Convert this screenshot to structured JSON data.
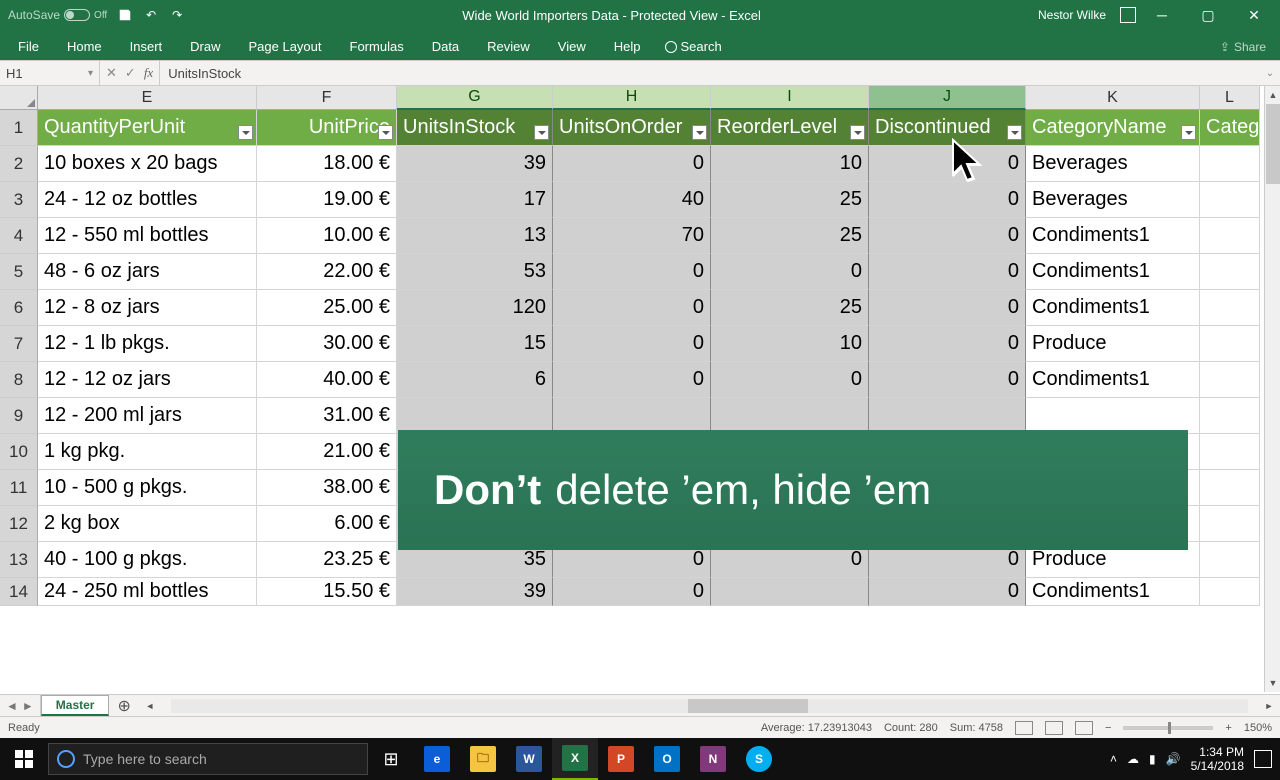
{
  "titlebar": {
    "autosave": "AutoSave",
    "autosave_state": "Off",
    "title": "Wide World Importers Data  -  Protected View  -  Excel",
    "user": "Nestor Wilke"
  },
  "ribbon": {
    "tabs": [
      "File",
      "Home",
      "Insert",
      "Draw",
      "Page Layout",
      "Formulas",
      "Data",
      "Review",
      "View",
      "Help"
    ],
    "search": "Search",
    "share": "Share"
  },
  "namebox": "H1",
  "formulabar": "UnitsInStock",
  "columns": [
    "E",
    "F",
    "G",
    "H",
    "I",
    "J",
    "K",
    "L"
  ],
  "selectedCols": [
    "G",
    "H",
    "I",
    "J"
  ],
  "hoverCol": "J",
  "headers": {
    "E": "QuantityPerUnit",
    "F": "UnitPrice",
    "G": "UnitsInStock",
    "H": "UnitsOnOrder",
    "I": "ReorderLevel",
    "J": "Discontinued",
    "K": "CategoryName",
    "L": "Categ"
  },
  "rows": [
    {
      "n": "2",
      "E": "10 boxes x 20 bags",
      "F": "18.00 €",
      "G": "39",
      "H": "0",
      "I": "10",
      "J": "0",
      "K": "Beverages"
    },
    {
      "n": "3",
      "E": "24 - 12 oz bottles",
      "F": "19.00 €",
      "G": "17",
      "H": "40",
      "I": "25",
      "J": "0",
      "K": "Beverages"
    },
    {
      "n": "4",
      "E": "12 - 550 ml bottles",
      "F": "10.00 €",
      "G": "13",
      "H": "70",
      "I": "25",
      "J": "0",
      "K": "Condiments1"
    },
    {
      "n": "5",
      "E": "48 - 6 oz jars",
      "F": "22.00 €",
      "G": "53",
      "H": "0",
      "I": "0",
      "J": "0",
      "K": "Condiments1"
    },
    {
      "n": "6",
      "E": "12 - 8 oz jars",
      "F": "25.00 €",
      "G": "120",
      "H": "0",
      "I": "25",
      "J": "0",
      "K": "Condiments1"
    },
    {
      "n": "7",
      "E": "12 - 1 lb pkgs.",
      "F": "30.00 €",
      "G": "15",
      "H": "0",
      "I": "10",
      "J": "0",
      "K": "Produce"
    },
    {
      "n": "8",
      "E": "12 - 12 oz jars",
      "F": "40.00 €",
      "G": "6",
      "H": "0",
      "I": "0",
      "J": "0",
      "K": "Condiments1"
    },
    {
      "n": "9",
      "E": "12 - 200 ml jars",
      "F": "31.00 €",
      "G": "",
      "H": "",
      "I": "",
      "J": "",
      "K": ""
    },
    {
      "n": "10",
      "E": "1 kg pkg.",
      "F": "21.00 €",
      "G": "",
      "H": "",
      "I": "",
      "J": "",
      "K": ""
    },
    {
      "n": "11",
      "E": "10 - 500 g pkgs.",
      "F": "38.00 €",
      "G": "",
      "H": "",
      "I": "",
      "J": "",
      "K": ""
    },
    {
      "n": "12",
      "E": "2 kg box",
      "F": "6.00 €",
      "G": "",
      "H": "",
      "I": "",
      "J": "",
      "K": ""
    },
    {
      "n": "13",
      "E": "40 - 100 g pkgs.",
      "F": "23.25 €",
      "G": "35",
      "H": "0",
      "I": "0",
      "J": "0",
      "K": "Produce"
    },
    {
      "n": "14",
      "E": "24 - 250 ml bottles",
      "F": "15.50 €",
      "G": "39",
      "H": "0",
      "I": "",
      "J": "0",
      "K": "Condiments1"
    }
  ],
  "banner": {
    "bold": "Don’t",
    "rest": "delete ’em, hide ’em"
  },
  "sheet_tab": "Master",
  "status": {
    "ready": "Ready",
    "avg": "Average: 17.23913043",
    "count": "Count: 280",
    "sum": "Sum: 4758",
    "zoom": "150%"
  },
  "taskbar": {
    "search_placeholder": "Type here to search",
    "time": "1:34 PM",
    "date": "5/14/2018"
  }
}
